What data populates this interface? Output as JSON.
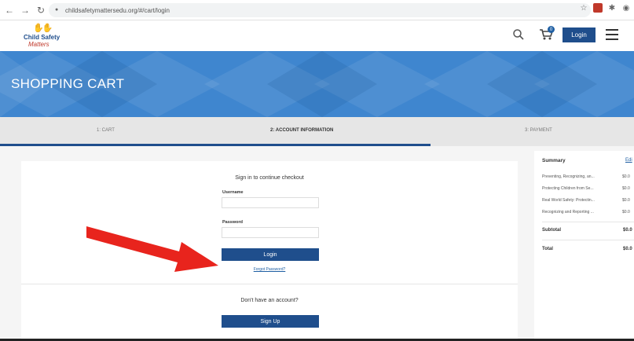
{
  "browser": {
    "url": "childsafetymattersedu.org/#/cart/login",
    "back_icon": "back-arrow-icon",
    "forward_icon": "forward-arrow-icon",
    "reload_icon": "reload-icon"
  },
  "header": {
    "logo_line1": "Child Safety",
    "logo_line2": "Matters",
    "login_label": "Login",
    "cart_count": "0"
  },
  "banner": {
    "title": "SHOPPING CART"
  },
  "steps": [
    {
      "label": "1: CART"
    },
    {
      "label": "2: ACCOUNT INFORMATION"
    },
    {
      "label": "3: PAYMENT"
    }
  ],
  "login_form": {
    "heading": "Sign in to continue checkout",
    "username_label": "Username",
    "username_value": "",
    "password_label": "Password",
    "password_value": "",
    "login_button": "Login",
    "forgot_link": "Forgot Password?",
    "no_account_text": "Don't have an account?",
    "signup_button": "Sign Up"
  },
  "summary": {
    "title": "Summary",
    "edit_link": "Edi",
    "items": [
      {
        "name": "Preventing, Recognizing, an...",
        "price": "$0.0"
      },
      {
        "name": "Protecting Children from Se...",
        "price": "$0.0"
      },
      {
        "name": "Real World Safety: Protectin...",
        "price": "$0.0"
      },
      {
        "name": "Recognizing and Reporting ...",
        "price": "$0.0"
      }
    ],
    "subtotal_label": "Subtotal",
    "subtotal_value": "$0.0",
    "total_label": "Total",
    "total_value": "$0.0"
  },
  "colors": {
    "brand_blue": "#1f4e8c",
    "banner_blue": "#3f86cf",
    "arrow_red": "#e8241d"
  }
}
